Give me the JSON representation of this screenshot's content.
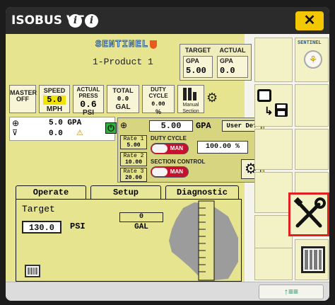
{
  "window": {
    "title": "ISOBUS VT",
    "close_symbol": "✕"
  },
  "header": {
    "brand": "SENTINEL",
    "product": "1-Product 1",
    "target_label": "TARGET",
    "actual_label": "ACTUAL",
    "target_unit": "GPA",
    "actual_unit": "GPA",
    "target_value": "5.00",
    "actual_value": "0.0"
  },
  "status": {
    "master": "MASTER\nOFF",
    "speed": {
      "label": "SPEED",
      "value": "5.0",
      "unit": "MPH"
    },
    "actual_press": {
      "label": "ACTUAL\nPRESS",
      "value": "0.6",
      "unit": "PSI"
    },
    "total": {
      "label": "TOTAL",
      "value": "0.0",
      "unit": "GAL"
    },
    "duty_cycle": {
      "label": "DUTY\nCYCLE",
      "value": "0.00",
      "unit": "%"
    },
    "manual_section": "Manual\nSection"
  },
  "product_line": {
    "rate": "5.0 GPA",
    "actual": "0.0"
  },
  "rate_panel": {
    "set_value": "5.00",
    "unit": "GPA",
    "mode": "User Def",
    "rates": [
      {
        "label": "Rate 1",
        "value": "5.00"
      },
      {
        "label": "Rate 2",
        "value": "10.00"
      },
      {
        "label": "Rate 3",
        "value": "20.00"
      }
    ],
    "duty_cycle_label": "DUTY CYCLE",
    "duty_toggle": "MAN",
    "duty_value": "100.00",
    "duty_unit": "%",
    "section_control_label": "SECTION CONTROL",
    "section_toggle": "MAN"
  },
  "tabs": [
    "Operate",
    "Setup",
    "Diagnostic"
  ],
  "operate": {
    "target_label": "Target",
    "target_value": "130.0",
    "target_unit": "PSI",
    "tank_value": "0",
    "tank_unit": "GAL"
  },
  "right_logo": "SENTINEL",
  "bottom_button": "↑≡≡",
  "colors": {
    "panel": "#e6e48e",
    "accent_yellow": "#f3c800",
    "highlight_red": "#e02020",
    "button_green": "#128c5a"
  }
}
